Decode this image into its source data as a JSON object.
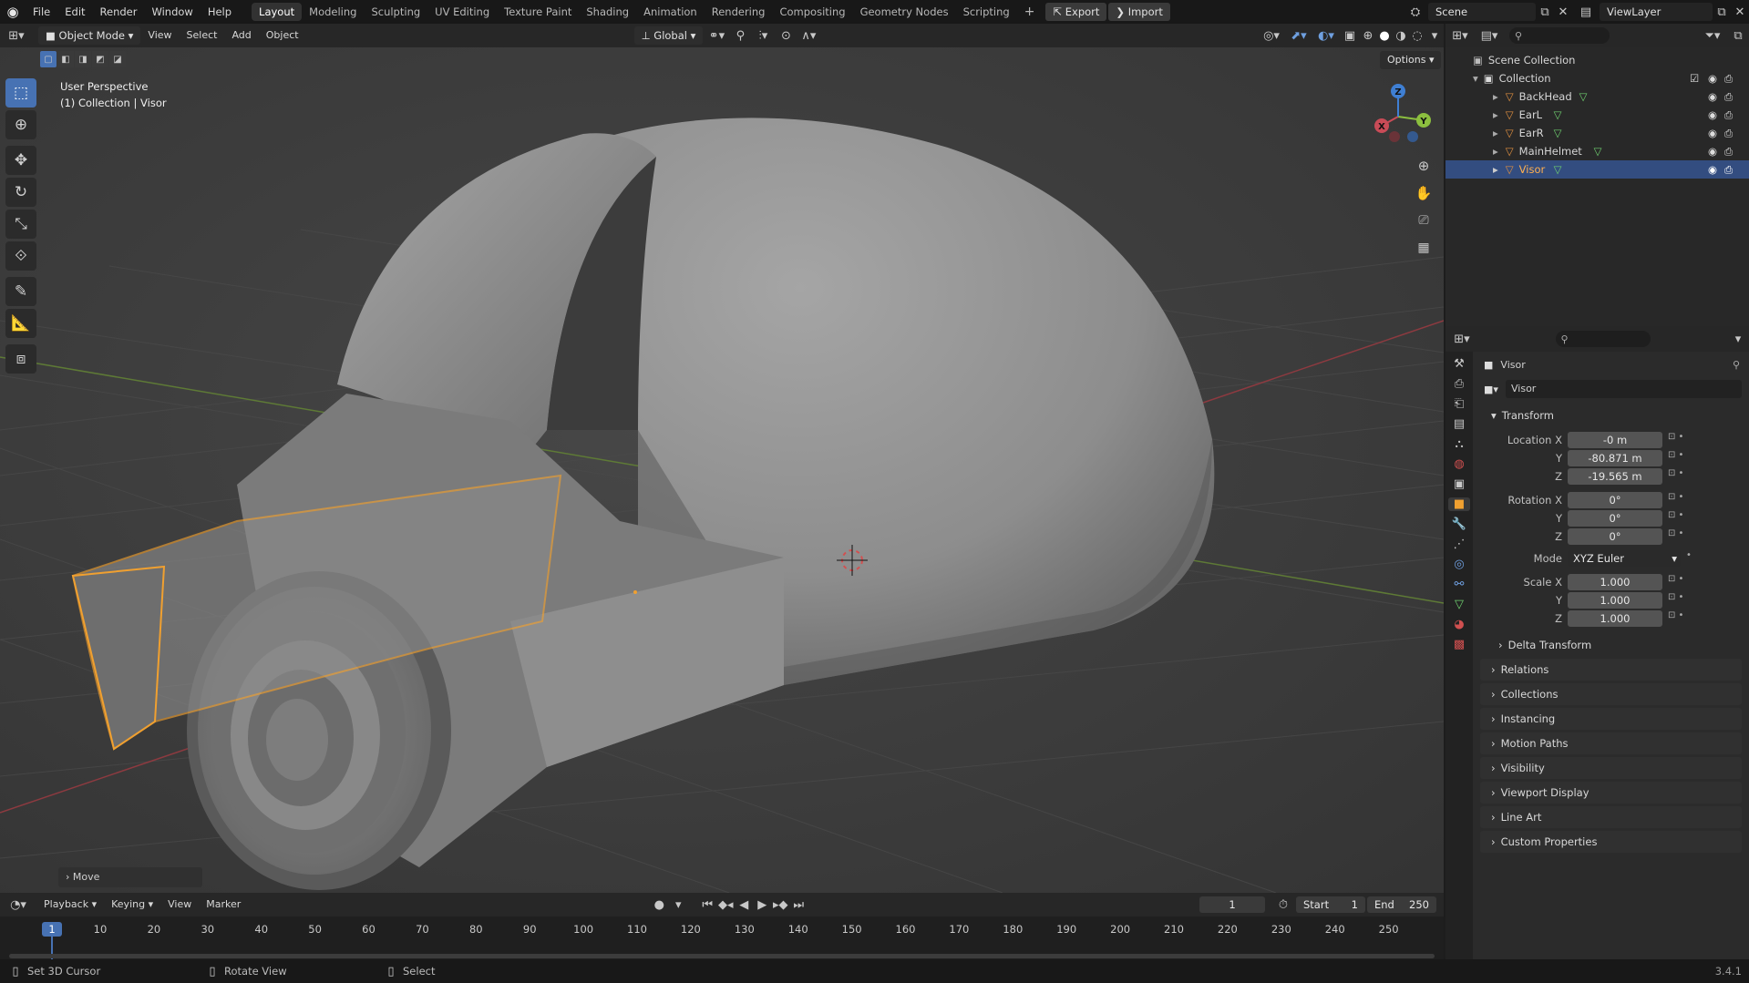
{
  "topbar": {
    "menus": [
      "File",
      "Edit",
      "Render",
      "Window",
      "Help"
    ],
    "workspaces": [
      "Layout",
      "Modeling",
      "Sculpting",
      "UV Editing",
      "Texture Paint",
      "Shading",
      "Animation",
      "Rendering",
      "Compositing",
      "Geometry Nodes",
      "Scripting"
    ],
    "add_workspace": "+",
    "export_label": "Export",
    "import_label": "Import",
    "scene_name": "Scene",
    "view_layer": "ViewLayer"
  },
  "viewport_header": {
    "mode": "Object Mode",
    "menus": [
      "View",
      "Select",
      "Add",
      "Object"
    ],
    "orientation": "Global",
    "options_label": "Options"
  },
  "viewport": {
    "perspective": "User Perspective",
    "collection_info": "(1) Collection | Visor",
    "operator_panel": "Move",
    "gizmo": {
      "x": "X",
      "y": "Y",
      "z": "Z"
    }
  },
  "outliner": {
    "scene_collection": "Scene Collection",
    "collection": "Collection",
    "objects": [
      {
        "name": "BackHead",
        "selected": false
      },
      {
        "name": "EarL",
        "selected": false
      },
      {
        "name": "EarR",
        "selected": false
      },
      {
        "name": "MainHelmet",
        "selected": false
      },
      {
        "name": "Visor",
        "selected": true
      }
    ]
  },
  "properties": {
    "object_title": "Visor",
    "object_name_field": "Visor",
    "transform_header": "Transform",
    "location_label": "Location X",
    "location": {
      "x": "-0 m",
      "y": "-80.871 m",
      "z": "-19.565 m"
    },
    "rotation_label": "Rotation X",
    "rotation": {
      "x": "0°",
      "y": "0°",
      "z": "0°"
    },
    "mode_label": "Mode",
    "mode_value": "XYZ Euler",
    "scale_label": "Scale X",
    "scale": {
      "x": "1.000",
      "y": "1.000",
      "z": "1.000"
    },
    "axis_y": "Y",
    "axis_z": "Z",
    "delta_transform": "Delta Transform",
    "panels": [
      "Relations",
      "Collections",
      "Instancing",
      "Motion Paths",
      "Visibility",
      "Viewport Display",
      "Line Art",
      "Custom Properties"
    ]
  },
  "timeline": {
    "menus": [
      "Playback",
      "Keying",
      "View",
      "Marker"
    ],
    "current_frame": "1",
    "start_label": "Start",
    "start_value": "1",
    "end_label": "End",
    "end_value": "250",
    "ruler": [
      "1",
      "10",
      "20",
      "30",
      "40",
      "50",
      "60",
      "70",
      "80",
      "90",
      "100",
      "110",
      "120",
      "130",
      "140",
      "150",
      "160",
      "170",
      "180",
      "190",
      "200",
      "210",
      "220",
      "230",
      "240",
      "250"
    ]
  },
  "statusbar": {
    "hint_cursor": "Set 3D Cursor",
    "hint_rotate": "Rotate View",
    "hint_select": "Select",
    "version": "3.4.1"
  },
  "colors": {
    "accent": "#4772b3",
    "selection_outline": "#f0a030",
    "viewport_bg": "#3d3d3d",
    "x_axis": "#c84b57",
    "y_axis": "#8cbf3f",
    "z_axis": "#3f7fd3"
  }
}
